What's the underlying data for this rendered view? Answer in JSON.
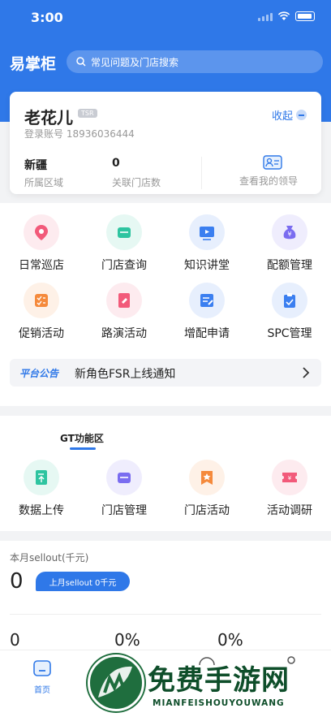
{
  "status_bar": {
    "time": "3:00"
  },
  "header": {
    "app_name": "易掌柜",
    "search_placeholder": "常见问题及门店搜索"
  },
  "user_card": {
    "name": "老花儿",
    "role_tag": "TSR",
    "collapse_label": "收起",
    "account": "登录账号 18936036444",
    "region_value": "新疆",
    "region_label": "所属区域",
    "stores_value": "0",
    "stores_label": "关联门店数",
    "leader_label": "查看我的领导"
  },
  "main_grid": [
    {
      "label": "日常巡店",
      "icon": "location-pin-icon",
      "color": "#f25a7a"
    },
    {
      "label": "门店查询",
      "icon": "store-icon",
      "color": "#2ec4a0"
    },
    {
      "label": "知识讲堂",
      "icon": "video-play-icon",
      "color": "#3b7ff0"
    },
    {
      "label": "配额管理",
      "icon": "money-bag-icon",
      "color": "#7a6cf0"
    },
    {
      "label": "促销活动",
      "icon": "checklist-icon",
      "color": "#f58a3c"
    },
    {
      "label": "路演活动",
      "icon": "edit-card-icon",
      "color": "#f25a7a"
    },
    {
      "label": "增配申请",
      "icon": "apply-form-icon",
      "color": "#3b7ff0"
    },
    {
      "label": "SPC管理",
      "icon": "clipboard-check-icon",
      "color": "#3b7ff0"
    }
  ],
  "notice": {
    "tag": "平台公告",
    "text": "新角色FSR上线通知"
  },
  "gt_section": {
    "title": "GT功能区",
    "items": [
      {
        "label": "数据上传",
        "icon": "upload-doc-icon",
        "color": "#2ec4a0"
      },
      {
        "label": "门店管理",
        "icon": "store-icon",
        "color": "#7a6cf0"
      },
      {
        "label": "门店活动",
        "icon": "star-flag-icon",
        "color": "#f58a3c"
      },
      {
        "label": "活动调研",
        "icon": "ticket-icon",
        "color": "#f25a7a"
      }
    ]
  },
  "sellout": {
    "title": "本月sellout(千元)",
    "value": "0",
    "last_month": "上月sellout 0千元",
    "stats": [
      "0",
      "0%",
      "0%"
    ]
  },
  "tabbar": {
    "home_label": "首页"
  },
  "watermark": {
    "title": "免费手游网",
    "subtitle": "MIANFEISHOUYOUWANG"
  },
  "colors": {
    "primary": "#2f78e8"
  }
}
